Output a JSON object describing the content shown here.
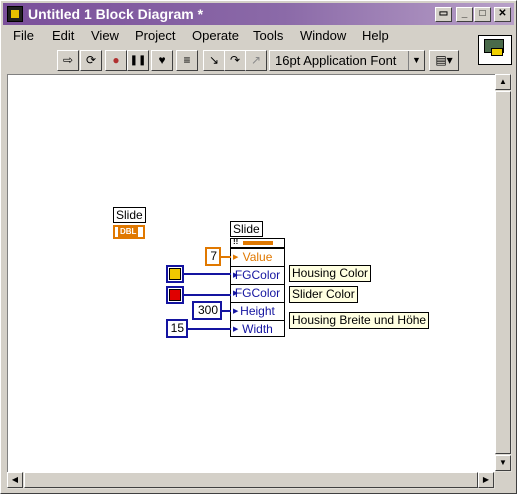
{
  "window": {
    "title": "Untitled 1 Block Diagram *",
    "buttons": [
      "▭",
      "_",
      "□",
      "✕"
    ]
  },
  "menu": [
    "File",
    "Edit",
    "View",
    "Project",
    "Operate",
    "Tools",
    "Window",
    "Help"
  ],
  "toolbar": {
    "tools": [
      {
        "icon": "run-arrow-icon",
        "glyph": "⇨"
      },
      {
        "icon": "run-continuously-icon",
        "glyph": "⟳"
      },
      {
        "icon": "abort-icon",
        "glyph": "●"
      },
      {
        "icon": "pause-icon",
        "glyph": "❚❚"
      },
      {
        "icon": "highlight-execution-bulb-icon",
        "glyph": "♥"
      },
      {
        "icon": "retain-wire-values-icon",
        "glyph": "≡"
      },
      {
        "icon": "step-into-icon",
        "glyph": "↘"
      },
      {
        "icon": "step-over-icon",
        "glyph": "↷"
      },
      {
        "icon": "step-out-icon",
        "glyph": "↗"
      }
    ],
    "font": "16pt Application Font",
    "align": "▤▾"
  },
  "diagram": {
    "slide_terminal_label": "Slide",
    "slide_terminal_type": "DBL",
    "bundler_label": "Slide",
    "bundler_rows": [
      {
        "label": "Value",
        "color": "orange"
      },
      {
        "label": "FGColor",
        "color": "blue"
      },
      {
        "label": "FGColor",
        "color": "blue"
      },
      {
        "label": "Height",
        "color": "blue"
      },
      {
        "label": "Width",
        "color": "blue"
      }
    ],
    "constants": {
      "value": "7",
      "height": "300",
      "width": "15"
    },
    "colors": {
      "housing": "#f0c800",
      "slider": "#e00000",
      "orange_wire": "#e07800",
      "blue_wire": "#1414a0"
    },
    "notes": {
      "housing": "Housing Color",
      "slider": "Slider Color",
      "size": "Housing Breite und Höhe"
    }
  }
}
